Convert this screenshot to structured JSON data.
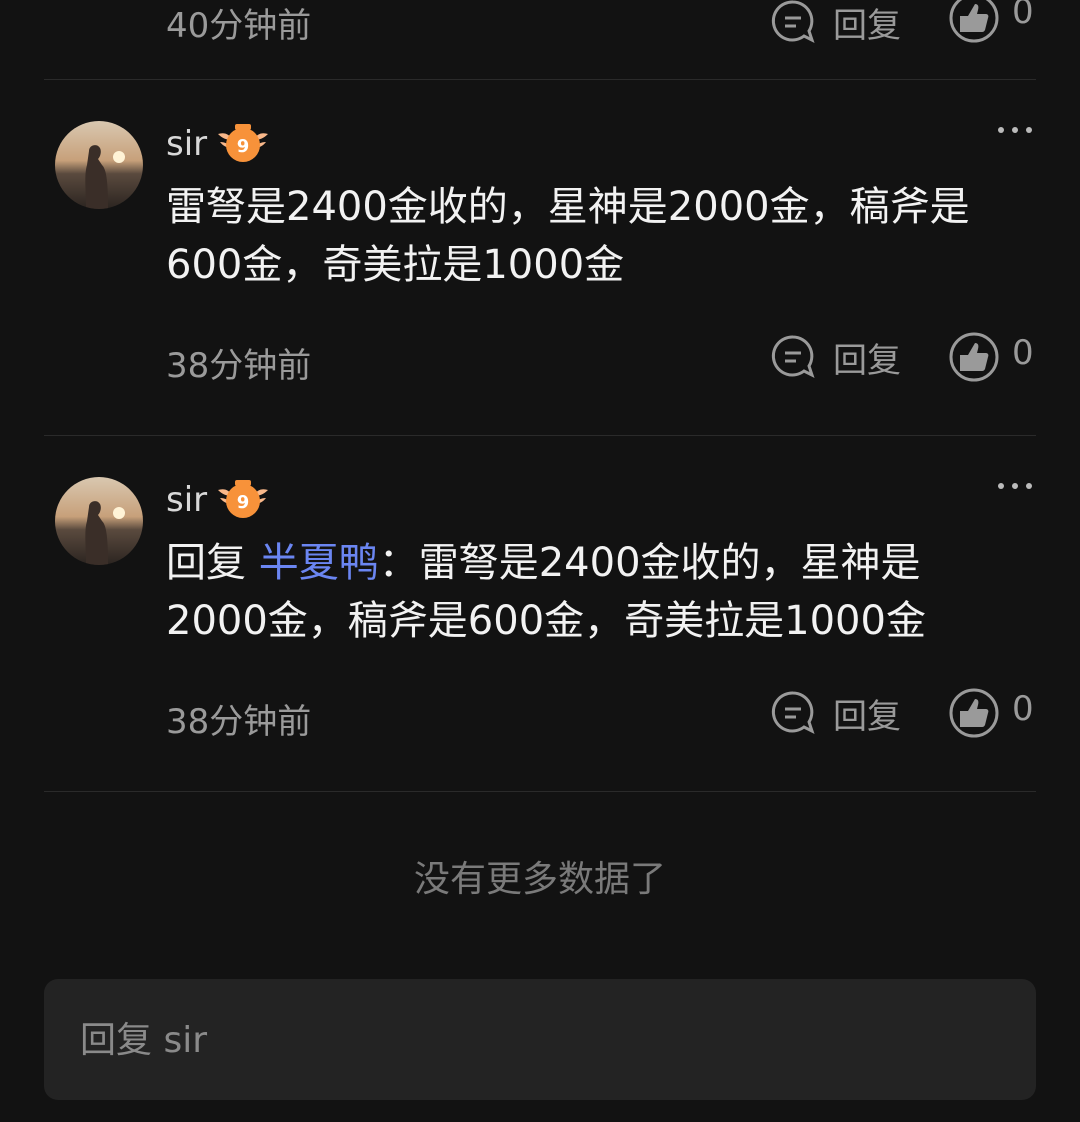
{
  "top_partial": {
    "time": "40分钟前",
    "reply_label": "回复",
    "like_count": "0"
  },
  "comments": [
    {
      "username": "sir",
      "level": "9",
      "text": "雷弩是2400金收的，星神是2000金，稿斧是600金，奇美拉是1000金",
      "time": "38分钟前",
      "reply_label": "回复",
      "like_count": "0"
    },
    {
      "username": "sir",
      "level": "9",
      "reply_prefix": "回复",
      "reply_to": "半夏鸭",
      "reply_sep": "：",
      "text": "雷弩是2400金收的，星神是2000金，稿斧是600金，奇美拉是1000金",
      "time": "38分钟前",
      "reply_label": "回复",
      "like_count": "0"
    }
  ],
  "footer": {
    "no_more": "没有更多数据了"
  },
  "reply_input": {
    "placeholder": "回复 sir"
  },
  "colors": {
    "background": "#121212",
    "link": "#6b86f2",
    "badge": "#f7923a"
  }
}
